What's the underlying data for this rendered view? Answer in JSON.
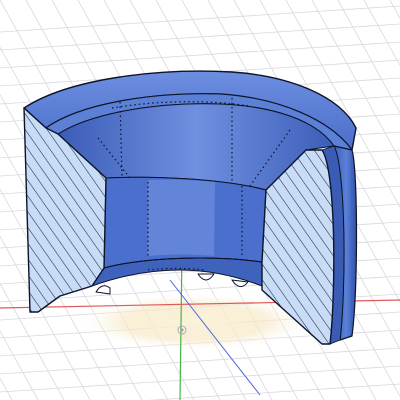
{
  "viewport": {
    "background": "#ffffff",
    "grid_color": "#d8d8e0",
    "origin_color": "#c9c9c9"
  },
  "axes": {
    "x_color": "#e05858",
    "y_color": "#46b446",
    "z_color": "#4a66d8"
  },
  "model": {
    "name": "section-view-bushing",
    "body_color": "#4e74d0",
    "body_light": "#7e9ce6",
    "body_dark": "#2e4ea6",
    "hatch_bg": "#c8dcf6",
    "hatch_line": "#1c2a4c",
    "outline": "#0c1428",
    "shadow_color": "#f6e6c0"
  }
}
